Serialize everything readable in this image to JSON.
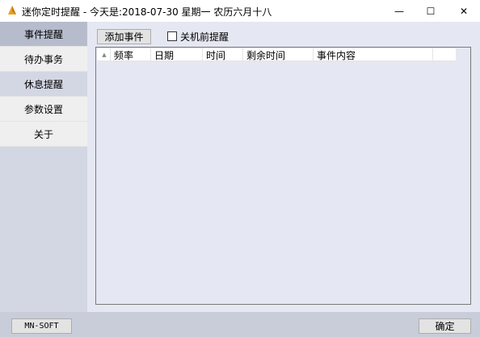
{
  "window": {
    "title": "迷你定时提醒 - 今天是:2018-07-30 星期一 农历六月十八",
    "controls": {
      "minimize": "—",
      "maximize": "☐",
      "close": "✕"
    },
    "icon_color": "#e8a020"
  },
  "sidebar": {
    "items": [
      {
        "label": "事件提醒",
        "state": "active"
      },
      {
        "label": "待办事务",
        "state": "normal"
      },
      {
        "label": "休息提醒",
        "state": "hover"
      },
      {
        "label": "参数设置",
        "state": "normal"
      },
      {
        "label": "关于",
        "state": "normal"
      }
    ]
  },
  "toolbar": {
    "add_label": "添加事件",
    "shutdown_remind_label": "关机前提醒",
    "shutdown_remind_checked": false
  },
  "table": {
    "columns": [
      "频率",
      "日期",
      "时间",
      "剩余时间",
      "事件内容"
    ],
    "rows": []
  },
  "footer": {
    "brand_label": "MN-SOFT",
    "ok_label": "确定"
  },
  "colors": {
    "sidebar_active": "#b7bccd",
    "sidebar_hover": "#d7dbe7",
    "sidebar_normal": "#efefef",
    "main_bg": "#e5e7f2",
    "footer_bg": "#c9ccd9"
  }
}
